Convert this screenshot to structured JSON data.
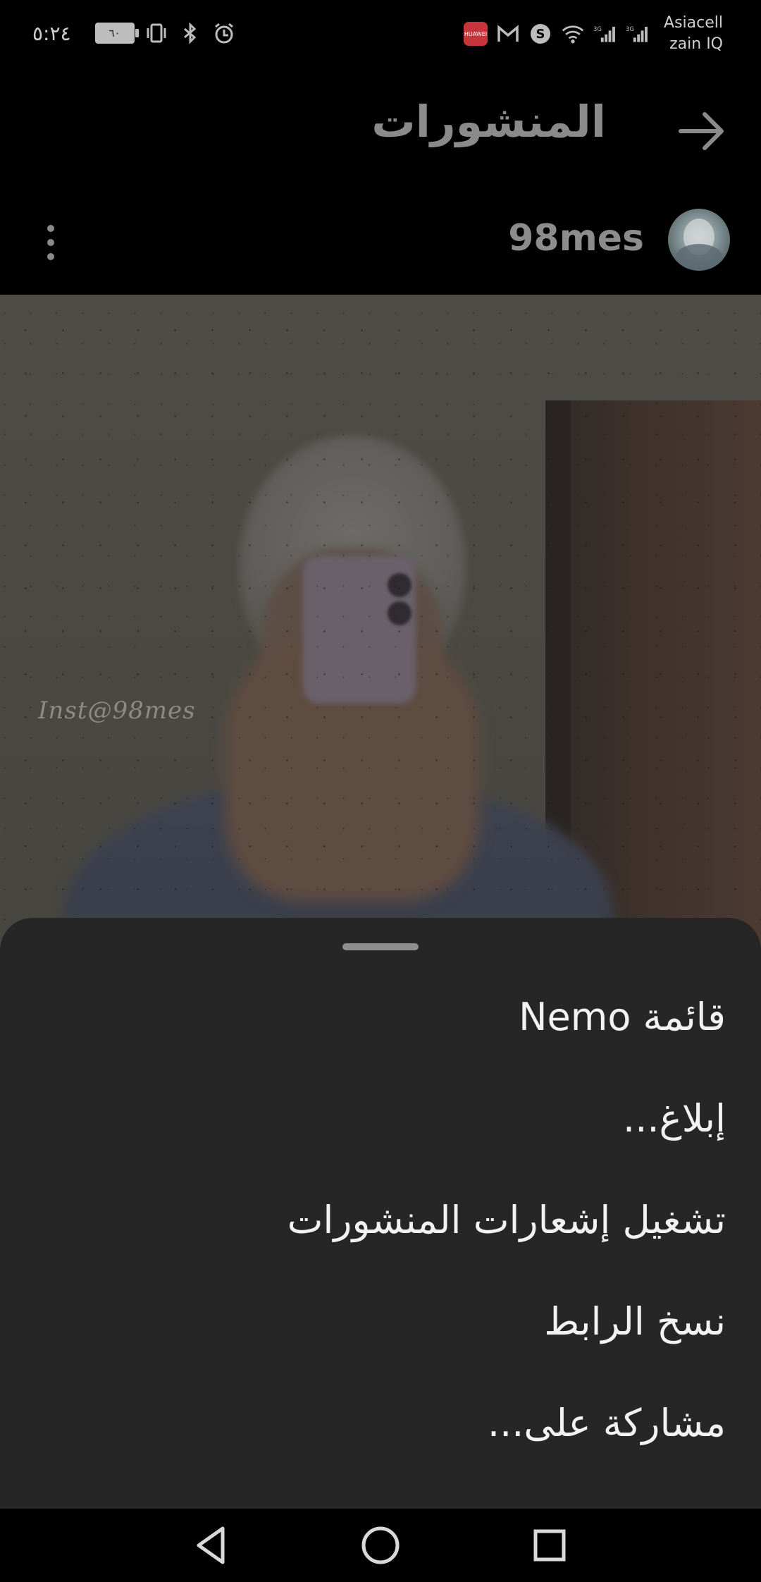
{
  "status_bar": {
    "time": "٥:٢٤",
    "battery_level": "٦٠",
    "notification_badge": "HUAWEI",
    "network_type_1": "3G",
    "network_type_2": "3G",
    "carrier_1": "Asiacell",
    "carrier_2": "zain IQ",
    "icons": [
      "huawei-app-icon",
      "gmail-icon",
      "s-app-icon",
      "wifi-icon",
      "signal-icon",
      "signal-icon",
      "vibrate-icon",
      "bluetooth-icon",
      "alarm-icon"
    ]
  },
  "header": {
    "title": "المنشورات",
    "back_icon": "arrow-right-icon"
  },
  "profile": {
    "username": "98mes",
    "more_icon": "more-vertical-icon"
  },
  "post": {
    "watermark": "Inst@98mes"
  },
  "bottom_sheet": {
    "items": [
      {
        "label": "قائمة Nemo"
      },
      {
        "label": "إبلاغ..."
      },
      {
        "label": "تشغيل إشعارات المنشورات"
      },
      {
        "label": "نسخ الرابط"
      },
      {
        "label": "مشاركة على..."
      }
    ]
  },
  "nav_bar": {
    "icons": [
      "back-triangle-icon",
      "home-circle-icon",
      "recents-square-icon"
    ]
  },
  "colors": {
    "background": "#000000",
    "sheet": "#262626",
    "sheet_text": "#f2f2f2",
    "dimmed_text": "#8a8a8a"
  }
}
